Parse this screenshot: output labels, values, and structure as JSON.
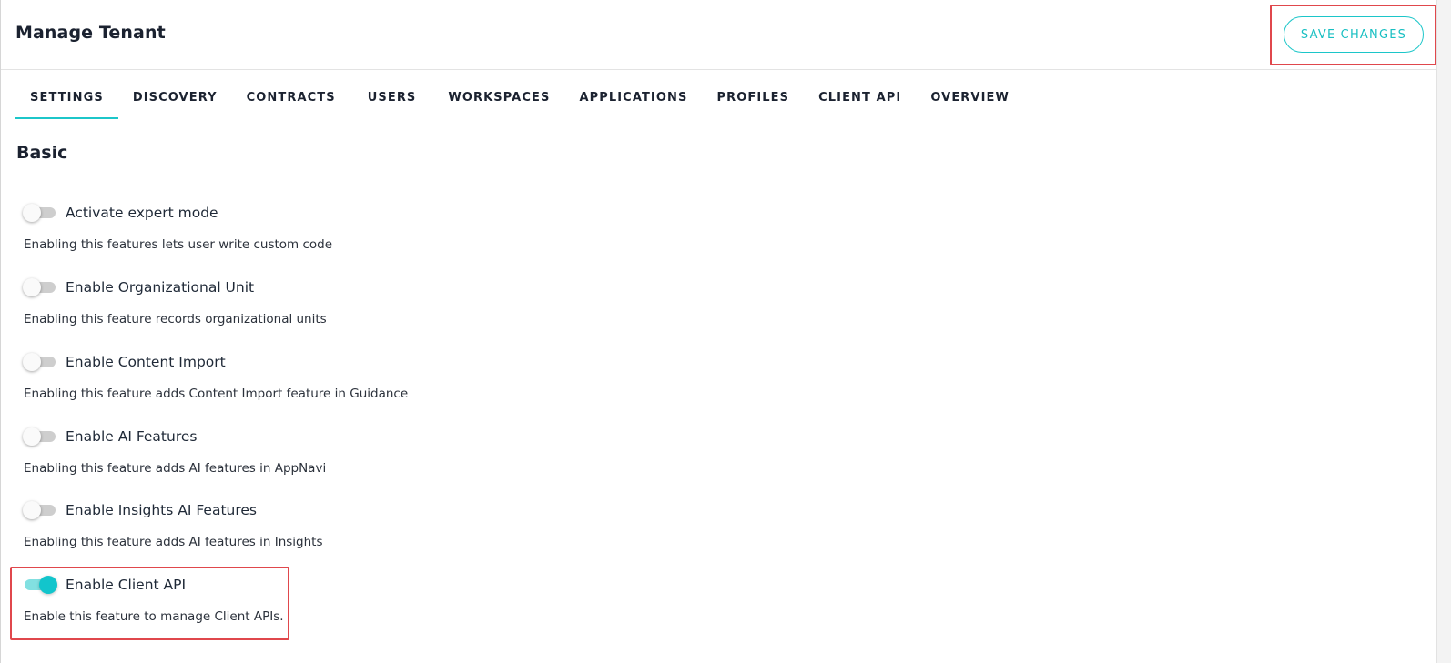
{
  "header": {
    "title": "Manage Tenant",
    "save_label": "SAVE CHANGES"
  },
  "tabs": [
    {
      "label": "SETTINGS",
      "active": true
    },
    {
      "label": "DISCOVERY"
    },
    {
      "label": "CONTRACTS"
    },
    {
      "label": "USERS"
    },
    {
      "label": "WORKSPACES"
    },
    {
      "label": "APPLICATIONS"
    },
    {
      "label": "PROFILES"
    },
    {
      "label": "CLIENT API"
    },
    {
      "label": "OVERVIEW"
    }
  ],
  "section": {
    "title": "Basic"
  },
  "settings": [
    {
      "label": "Activate expert mode",
      "description": "Enabling this features lets user write custom code",
      "enabled": false
    },
    {
      "label": "Enable Organizational Unit",
      "description": "Enabling this feature records organizational units",
      "enabled": false
    },
    {
      "label": "Enable Content Import",
      "description": "Enabling this feature adds Content Import feature in Guidance",
      "enabled": false
    },
    {
      "label": "Enable AI Features",
      "description": "Enabling this feature adds AI features in AppNavi",
      "enabled": false
    },
    {
      "label": "Enable Insights AI Features",
      "description": "Enabling this feature adds AI features in Insights",
      "enabled": false
    },
    {
      "label": "Enable Client API",
      "description": "Enable this feature to manage Client APIs.",
      "enabled": true
    }
  ],
  "colors": {
    "accent": "#1cc6c9",
    "highlight": "#e0474c",
    "text": "#1b2230"
  }
}
